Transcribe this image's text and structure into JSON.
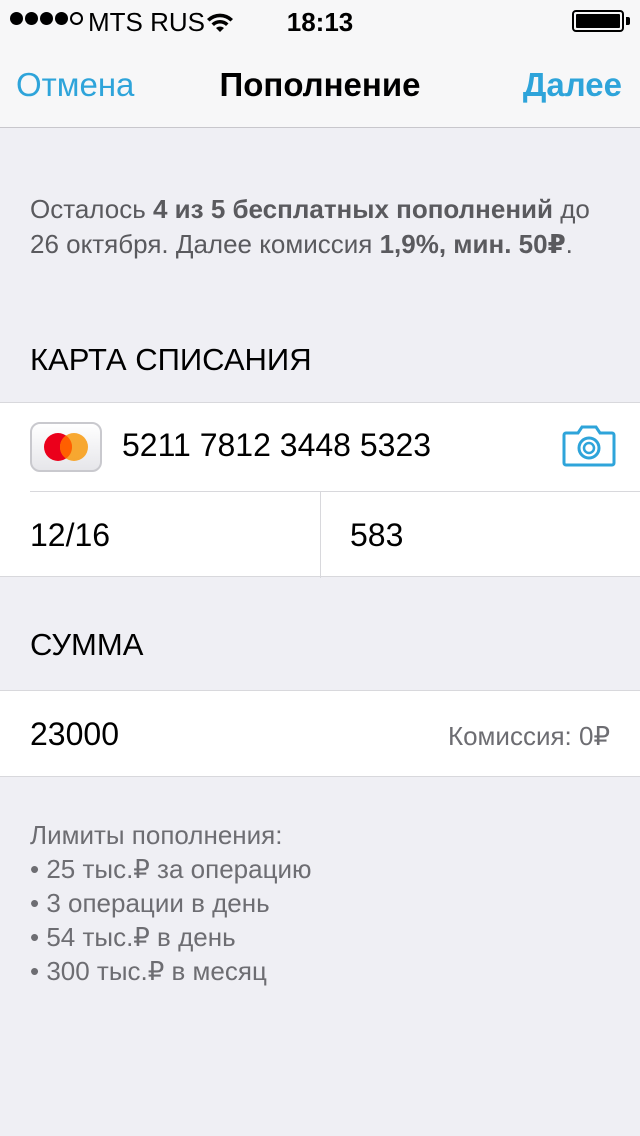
{
  "status_bar": {
    "carrier": "MTS RUS",
    "time": "18:13",
    "signal_bars_filled": 4,
    "signal_bars_total": 5
  },
  "nav": {
    "cancel_label": "Отмена",
    "title": "Пополнение",
    "next_label": "Далее"
  },
  "info": {
    "part1": "Осталось ",
    "bold1": "4 из 5 бесплатных пополнений",
    "part2": " до 26 октября. Далее комиссия ",
    "bold2": "1,9%, мин. 50₽",
    "part3": "."
  },
  "card_section": {
    "header": "КАРТА СПИСАНИЯ",
    "card_brand_icon": "mastercard-icon",
    "card_number": "5211 7812 3448 5323",
    "expiry": "12/16",
    "cvc": "583",
    "scan_icon": "camera-icon"
  },
  "amount_section": {
    "header": "СУММА",
    "amount": "23000",
    "commission": "Комиссия: 0₽"
  },
  "limits": {
    "title": "Лимиты пополнения:",
    "items": [
      "• 25 тыс.₽ за операцию",
      "• 3 операции в день",
      "• 54 тыс.₽ в день",
      "• 300 тыс.₽ в месяц"
    ]
  },
  "colors": {
    "accent": "#2ea4da",
    "background": "#efeff4",
    "mastercard_red": "#eb001b",
    "mastercard_orange": "#f79e1b"
  }
}
